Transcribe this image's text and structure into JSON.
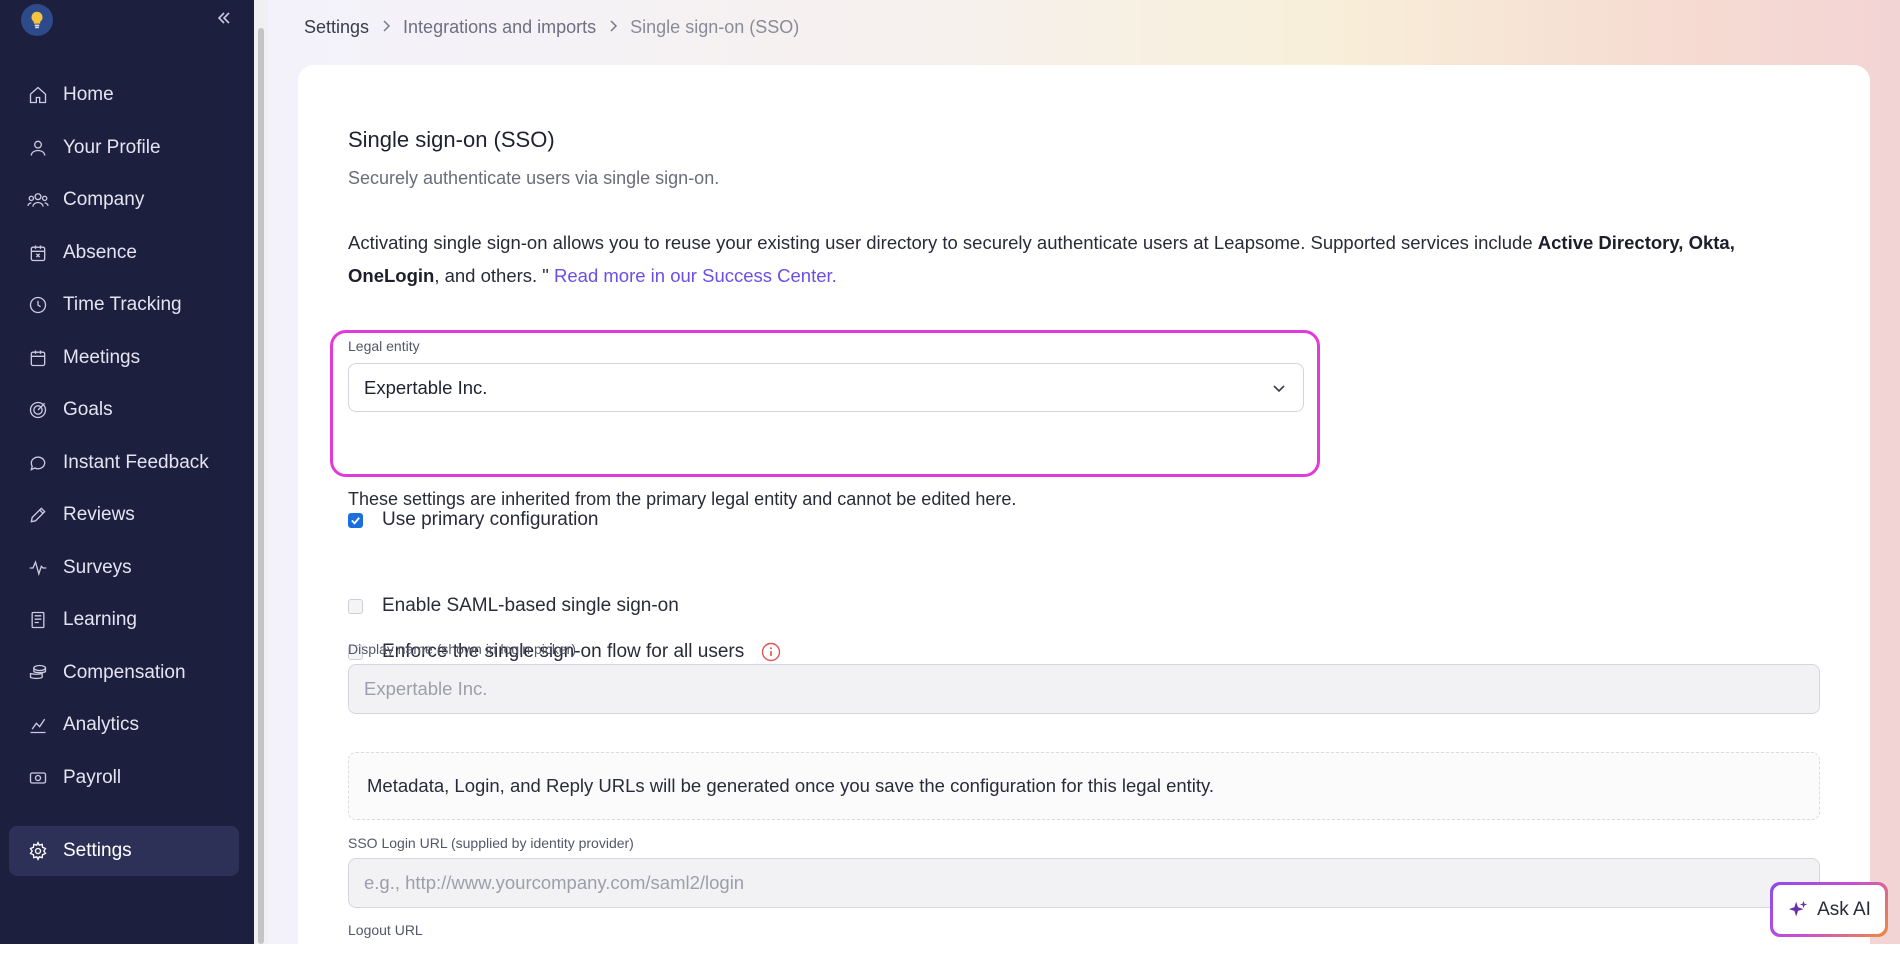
{
  "sidebar": {
    "collapse_label": "«",
    "items": [
      {
        "label": "Home",
        "icon": "home-icon"
      },
      {
        "label": "Your Profile",
        "icon": "user-icon"
      },
      {
        "label": "Company",
        "icon": "users-icon"
      },
      {
        "label": "Absence",
        "icon": "calendar-x-icon"
      },
      {
        "label": "Time Tracking",
        "icon": "clock-icon"
      },
      {
        "label": "Meetings",
        "icon": "calendar-icon"
      },
      {
        "label": "Goals",
        "icon": "target-icon"
      },
      {
        "label": "Instant Feedback",
        "icon": "chat-bubble-icon"
      },
      {
        "label": "Reviews",
        "icon": "pencil-icon"
      },
      {
        "label": "Surveys",
        "icon": "pulse-icon"
      },
      {
        "label": "Learning",
        "icon": "book-icon"
      },
      {
        "label": "Compensation",
        "icon": "coins-icon"
      },
      {
        "label": "Analytics",
        "icon": "chart-icon"
      },
      {
        "label": "Payroll",
        "icon": "money-icon"
      }
    ],
    "settings_label": "Settings"
  },
  "breadcrumb": {
    "items": [
      "Settings",
      "Integrations and imports",
      "Single sign-on (SSO)"
    ]
  },
  "page": {
    "title": "Single sign-on (SSO)",
    "subtitle": "Securely authenticate users via single sign-on.",
    "description_part1": "Activating single sign-on allows you to reuse your existing user directory to securely authenticate users at Leapsome. Supported services include ",
    "description_bold1": "Active Directory, Okta, OneLogin",
    "description_part2": ", and others. \" ",
    "description_link": "Read more in our Success Center."
  },
  "form": {
    "legal_entity_label": "Legal entity",
    "legal_entity_value": "Expertable Inc.",
    "use_primary_label": "Use primary configuration",
    "use_primary_checked": true,
    "inherited_note": "These settings are inherited from the primary legal entity and cannot be edited here.",
    "enable_saml_label": "Enable SAML-based single sign-on",
    "enable_saml_checked": false,
    "enforce_sso_label": "Enforce the single sign-on flow for all users",
    "enforce_sso_checked": false,
    "display_name_label": "Display name (shown in login picker)",
    "display_name_placeholder": "Expertable Inc.",
    "notice_text": "Metadata, Login, and Reply URLs will be generated once you save the configuration for this legal entity.",
    "sso_login_label": "SSO Login URL (supplied by identity provider)",
    "sso_login_placeholder": "e.g., http://www.yourcompany.com/saml2/login",
    "logout_label": "Logout URL"
  },
  "ask_ai": {
    "label": "Ask AI"
  },
  "colors": {
    "sidebar_bg": "#1d1f3f",
    "highlight": "#e23ad8",
    "link": "#6b4ee6",
    "checkbox_checked": "#1b6fdc"
  }
}
